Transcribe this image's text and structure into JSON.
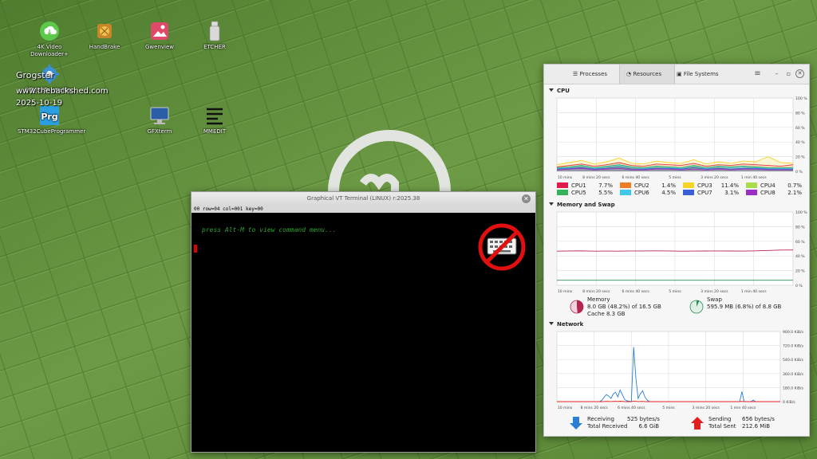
{
  "desktop": {
    "icons": [
      {
        "label": "4K Video Downloader+"
      },
      {
        "label": "HandBrake"
      },
      {
        "label": "Gwenview"
      },
      {
        "label": "ETCHER"
      },
      {
        "label": "STM32TrustedPac"
      },
      {
        "label": "STM32CubeProgrammer"
      },
      {
        "label": "GFXterm"
      },
      {
        "label": "MMEDIT"
      }
    ],
    "overlay": {
      "user": "Grogster",
      "site": "www.thebackshed.com",
      "date": "2025-10-19"
    }
  },
  "terminal": {
    "title": "Graphical VT Terminal (LINUX)  r:2025.38",
    "status": "00 row=04 col=001 key=00",
    "message": "press Alt-M to view command menu..."
  },
  "monitor": {
    "tabs": [
      "Processes",
      "Resources",
      "File Systems"
    ],
    "active_tab": "Resources",
    "sections": {
      "cpu": "CPU",
      "memory": "Memory and Swap",
      "network": "Network"
    },
    "time_ticks": [
      "10 mins",
      "8 mins 20 secs",
      "6 mins 40 secs",
      "5 mins",
      "3 mins 20 secs",
      "1 min 40 secs",
      "0 secs"
    ],
    "cpu": {
      "y_ticks": [
        "100 %",
        "80 %",
        "60 %",
        "40 %",
        "20 %",
        "0 %"
      ],
      "cores": [
        {
          "name": "CPU1",
          "value": "7.7%",
          "color": "#e01b4c"
        },
        {
          "name": "CPU2",
          "value": "1.4%",
          "color": "#f07c24"
        },
        {
          "name": "CPU3",
          "value": "11.4%",
          "color": "#f5d327"
        },
        {
          "name": "CPU4",
          "value": "0.7%",
          "color": "#a9dc4a"
        },
        {
          "name": "CPU5",
          "value": "5.5%",
          "color": "#36b15c"
        },
        {
          "name": "CPU6",
          "value": "4.5%",
          "color": "#3cc9e8"
        },
        {
          "name": "CPU7",
          "value": "3.1%",
          "color": "#3c5fd8"
        },
        {
          "name": "CPU8",
          "value": "2.1%",
          "color": "#9b2fc4"
        }
      ]
    },
    "memory": {
      "y_ticks": [
        "100 %",
        "80 %",
        "60 %",
        "40 %",
        "20 %",
        "0 %"
      ],
      "memory_label": "Memory",
      "memory_value": "8.0 GB (48.2%) of 16.5 GB",
      "cache_value": "Cache 8.3 GB",
      "memory_percent": 48.2,
      "swap_label": "Swap",
      "swap_value": "595.9 MB (6.8%) of 8.8 GB",
      "swap_percent": 6.8,
      "memory_color": "#b5244d",
      "swap_color": "#2e8b57"
    },
    "network": {
      "y_ticks": [
        "900.0 KiB/s",
        "720.0 KiB/s",
        "540.0 KiB/s",
        "360.0 KiB/s",
        "180.0 KiB/s",
        "0 KiB/s"
      ],
      "receiving_label": "Receiving",
      "receiving_value": "525 bytes/s",
      "total_received_label": "Total Received",
      "total_received_value": "6.6 GiB",
      "sending_label": "Sending",
      "sending_value": "656 bytes/s",
      "total_sent_label": "Total Sent",
      "total_sent_value": "212.6 MiB",
      "receive_color": "#2a7fd4",
      "send_color": "#e02020"
    }
  },
  "chart_data": [
    {
      "type": "line",
      "title": "CPU",
      "xlabel": "",
      "ylabel": "",
      "x_range": [
        "10 mins",
        "0 secs"
      ],
      "ylim": [
        0,
        100
      ],
      "grid": true,
      "series": [
        {
          "name": "CPU1",
          "values": [
            6,
            8,
            10,
            7,
            9,
            12,
            8,
            7,
            10,
            9,
            8,
            11,
            7,
            9,
            8,
            10,
            9,
            8,
            7,
            9
          ]
        },
        {
          "name": "CPU2",
          "values": [
            3,
            4,
            6,
            3,
            5,
            8,
            4,
            3,
            5,
            4,
            3,
            6,
            4,
            5,
            3,
            4,
            6,
            4,
            3,
            1
          ]
        },
        {
          "name": "CPU3",
          "values": [
            9,
            12,
            15,
            10,
            13,
            18,
            11,
            10,
            14,
            12,
            11,
            16,
            10,
            13,
            11,
            14,
            13,
            20,
            12,
            11
          ]
        },
        {
          "name": "CPU4",
          "values": [
            2,
            3,
            4,
            2,
            3,
            5,
            2,
            2,
            3,
            3,
            2,
            4,
            2,
            3,
            2,
            3,
            3,
            2,
            2,
            1
          ]
        },
        {
          "name": "CPU5",
          "values": [
            5,
            6,
            8,
            5,
            7,
            9,
            6,
            5,
            7,
            6,
            5,
            8,
            5,
            7,
            6,
            7,
            6,
            5,
            5,
            5
          ]
        },
        {
          "name": "CPU6",
          "values": [
            4,
            5,
            7,
            4,
            6,
            8,
            5,
            4,
            6,
            5,
            4,
            7,
            4,
            6,
            5,
            6,
            5,
            4,
            4,
            4
          ]
        },
        {
          "name": "CPU7",
          "values": [
            3,
            4,
            5,
            3,
            4,
            6,
            3,
            3,
            4,
            4,
            3,
            5,
            3,
            4,
            3,
            4,
            4,
            3,
            3,
            3
          ]
        },
        {
          "name": "CPU8",
          "values": [
            2,
            3,
            4,
            2,
            3,
            4,
            2,
            2,
            3,
            3,
            2,
            3,
            2,
            3,
            2,
            3,
            3,
            2,
            2,
            2
          ]
        }
      ]
    },
    {
      "type": "line",
      "title": "Memory and Swap",
      "xlabel": "",
      "ylabel": "",
      "x_range": [
        "10 mins",
        "0 secs"
      ],
      "ylim": [
        0,
        100
      ],
      "grid": true,
      "series": [
        {
          "name": "Memory",
          "values": [
            46.5,
            46.8,
            47,
            46.5,
            46.6,
            46.5,
            46.8,
            46.9,
            47,
            46.8,
            46.5,
            46.6,
            46.7,
            46.8,
            46.7,
            46.6,
            47,
            47.5,
            48,
            48.2
          ]
        },
        {
          "name": "Swap",
          "values": [
            6.8,
            6.8,
            6.8,
            6.8,
            6.8,
            6.8,
            6.8,
            6.8,
            6.8,
            6.8,
            6.8,
            6.8,
            6.8,
            6.8,
            6.8,
            6.8,
            6.8,
            6.8,
            6.8,
            6.8
          ]
        }
      ]
    },
    {
      "type": "line",
      "title": "Network",
      "xlabel": "",
      "ylabel": "",
      "x_range": [
        "10 mins",
        "0 secs"
      ],
      "ylim": [
        0,
        900
      ],
      "grid": true,
      "series": [
        {
          "name": "Receiving",
          "values": [
            0,
            0,
            0,
            0,
            0,
            0,
            0,
            0,
            0,
            0,
            0,
            0,
            0,
            0,
            0,
            0,
            0,
            0,
            0,
            0,
            20,
            60,
            90,
            70,
            40,
            100,
            120,
            60,
            150,
            90,
            30,
            10,
            5,
            0,
            700,
            300,
            40,
            100,
            140,
            60,
            20,
            0,
            0,
            0,
            0,
            0,
            0,
            0,
            0,
            0,
            0,
            0,
            0,
            0,
            0,
            0,
            0,
            0,
            0,
            0,
            0,
            0,
            0,
            0,
            0,
            0,
            0,
            0,
            0,
            0,
            0,
            0,
            0,
            0,
            0,
            0,
            0,
            0,
            0,
            0,
            0,
            0,
            130,
            0,
            0,
            0,
            0,
            20,
            0,
            0,
            0,
            0,
            0,
            0,
            0,
            0,
            0,
            0,
            0,
            0
          ]
        },
        {
          "name": "Sending",
          "values": [
            0,
            0,
            0,
            0,
            0,
            0,
            0,
            0,
            0,
            0,
            0,
            0,
            0,
            0,
            0,
            0,
            0,
            0,
            0,
            0,
            0,
            2,
            3,
            2,
            1,
            3,
            4,
            2,
            5,
            3,
            1,
            0,
            0,
            0,
            8,
            4,
            1,
            2,
            3,
            1,
            0,
            0,
            0,
            0,
            0,
            0,
            0,
            0,
            0,
            0,
            0,
            0,
            0,
            0,
            0,
            0,
            0,
            0,
            0,
            0,
            0,
            0,
            0,
            0,
            0,
            0,
            0,
            0,
            0,
            0,
            0,
            0,
            0,
            0,
            0,
            0,
            0,
            0,
            0,
            0,
            0,
            0,
            3,
            0,
            0,
            0,
            0,
            1,
            0,
            0,
            0,
            0,
            0,
            0,
            0,
            0,
            0,
            0,
            0,
            0
          ]
        }
      ]
    }
  ]
}
